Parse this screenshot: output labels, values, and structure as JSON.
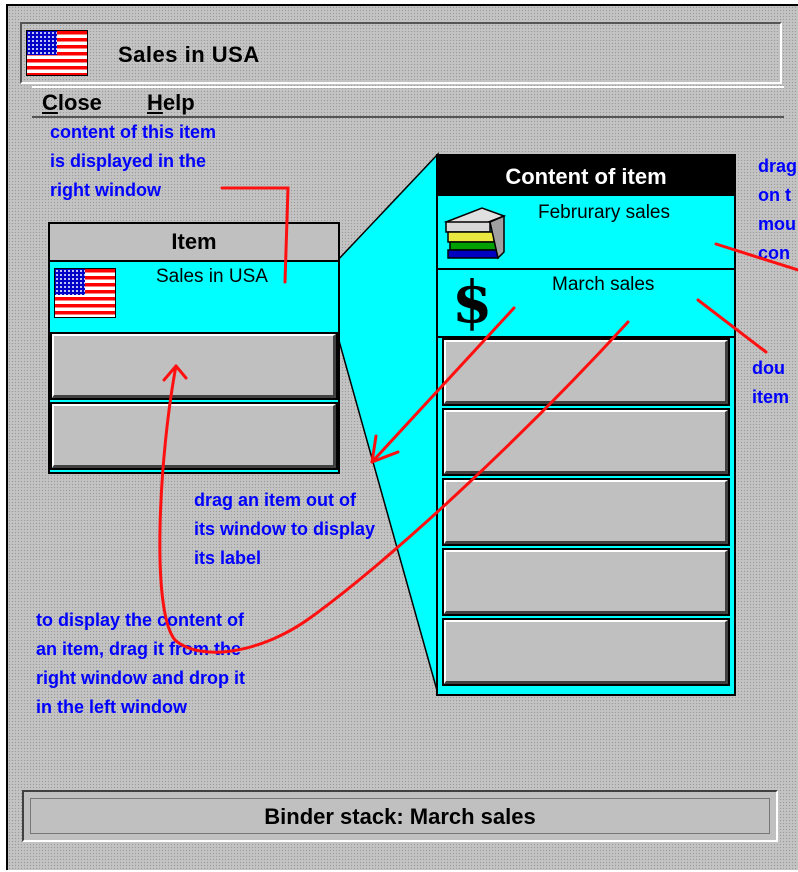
{
  "window": {
    "title": "Sales in USA",
    "title_icon": "us-flag-icon"
  },
  "menu": [
    {
      "underline": "C",
      "rest": "lose"
    },
    {
      "underline": "H",
      "rest": "elp"
    }
  ],
  "left_panel": {
    "header": "Item",
    "items": [
      {
        "icon": "us-flag-icon",
        "label": "Sales in USA"
      }
    ]
  },
  "right_panel": {
    "header": "Content of item",
    "items": [
      {
        "icon": "books-icon",
        "label": "Februrary sales"
      },
      {
        "icon": "dollar-icon",
        "glyph": "$",
        "label": "March sales"
      }
    ]
  },
  "annotations": {
    "content_note": "content of this item\nis displayed in the\nright window",
    "drag_out_note": "drag an item out of\nits window to display\nits label",
    "display_content_note": "to display the content of\nan item, drag it from the\nright window and drop it\nin the left window",
    "right_note_top": "drag\non t\nmou\ncon",
    "right_note_bottom": "dou\nitem"
  },
  "status": {
    "text": "Binder stack: March sales"
  },
  "colors": {
    "panel": "#00ffff",
    "annotation_text": "#0000ff",
    "annotation_arrow": "#ff0000",
    "header_bg_right": "#000000",
    "header_bg_left": "#c0c0c0"
  }
}
